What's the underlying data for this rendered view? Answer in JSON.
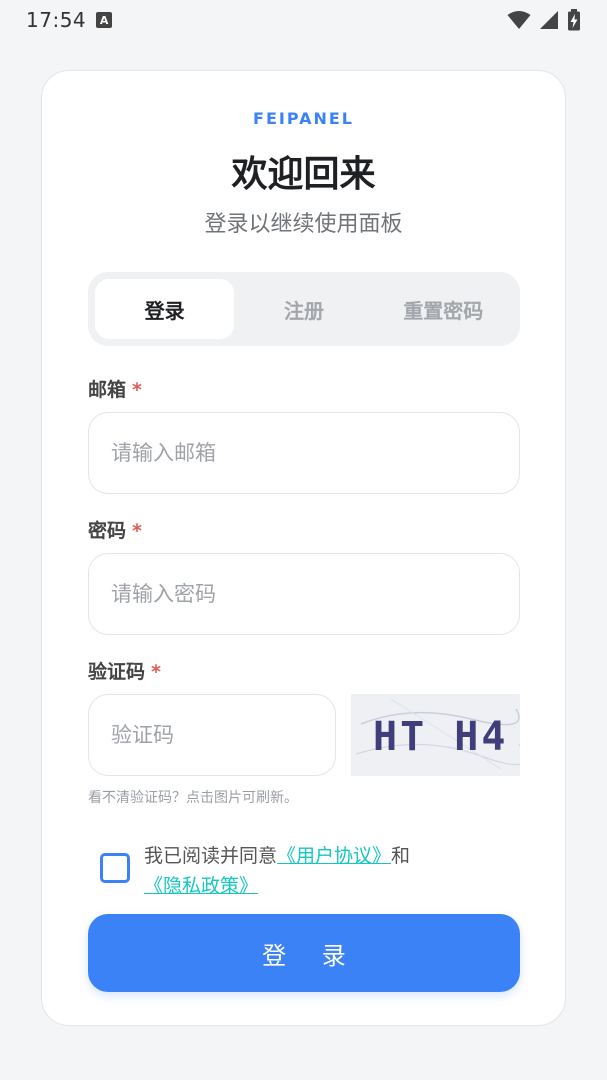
{
  "status_bar": {
    "time": "17:54",
    "notification_icon": "A"
  },
  "card": {
    "brand": "FEIPANEL",
    "title": "欢迎回来",
    "subtitle": "登录以继续使用面板"
  },
  "tabs": [
    {
      "label": "登录",
      "active": true
    },
    {
      "label": "注册",
      "active": false
    },
    {
      "label": "重置密码",
      "active": false
    }
  ],
  "form": {
    "email_label": "邮箱",
    "email_placeholder": "请输入邮箱",
    "password_label": "密码",
    "password_placeholder": "请输入密码",
    "captcha_label": "验证码",
    "captcha_placeholder": "验证码",
    "required_mark": "*",
    "captcha_text": "HT H4",
    "captcha_hint": "看不清验证码？点击图片可刷新。"
  },
  "agreement": {
    "prefix": "我已阅读并同意",
    "user_agreement": "《用户协议》",
    "and": "和",
    "privacy_policy": "《隐私政策》",
    "checked": false
  },
  "login_button": "登 录",
  "colors": {
    "accent": "#3b82f6",
    "link": "#14c7bf",
    "required": "#e25b52"
  }
}
